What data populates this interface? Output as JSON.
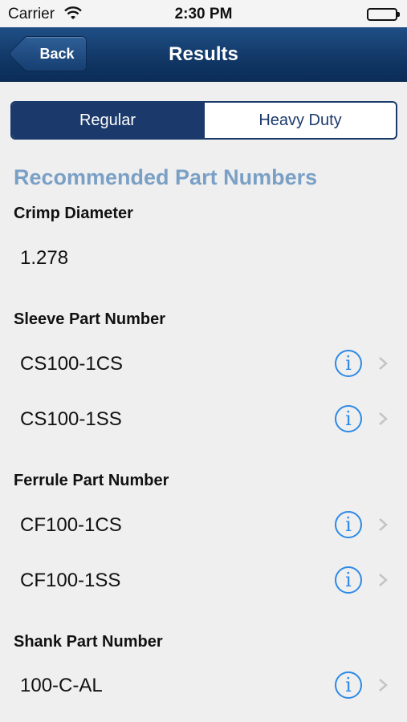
{
  "status_bar": {
    "carrier": "Carrier",
    "time": "2:30 PM"
  },
  "nav": {
    "back_label": "Back",
    "title": "Results"
  },
  "segments": [
    {
      "label": "Regular",
      "selected": true
    },
    {
      "label": "Heavy Duty",
      "selected": false
    }
  ],
  "section_title": "Recommended Part Numbers",
  "crimp": {
    "label": "Crimp Diameter",
    "value": "1.278"
  },
  "sleeve": {
    "label": "Sleeve Part Number",
    "parts": [
      "CS100-1CS",
      "CS100-1SS"
    ]
  },
  "ferrule": {
    "label": "Ferrule Part Number",
    "parts": [
      "CF100-1CS",
      "CF100-1SS"
    ]
  },
  "shank": {
    "label": "Shank Part Number",
    "parts": [
      "100-C-AL"
    ]
  },
  "colors": {
    "nav_bar": "#123968",
    "segment_active": "#1b3a6b",
    "section_header": "#7aa0c6",
    "info_icon": "#2d8ae6"
  },
  "icons": {
    "info": "info-circle-icon",
    "disclosure": "chevron-right-icon",
    "back": "back-arrow-icon"
  }
}
